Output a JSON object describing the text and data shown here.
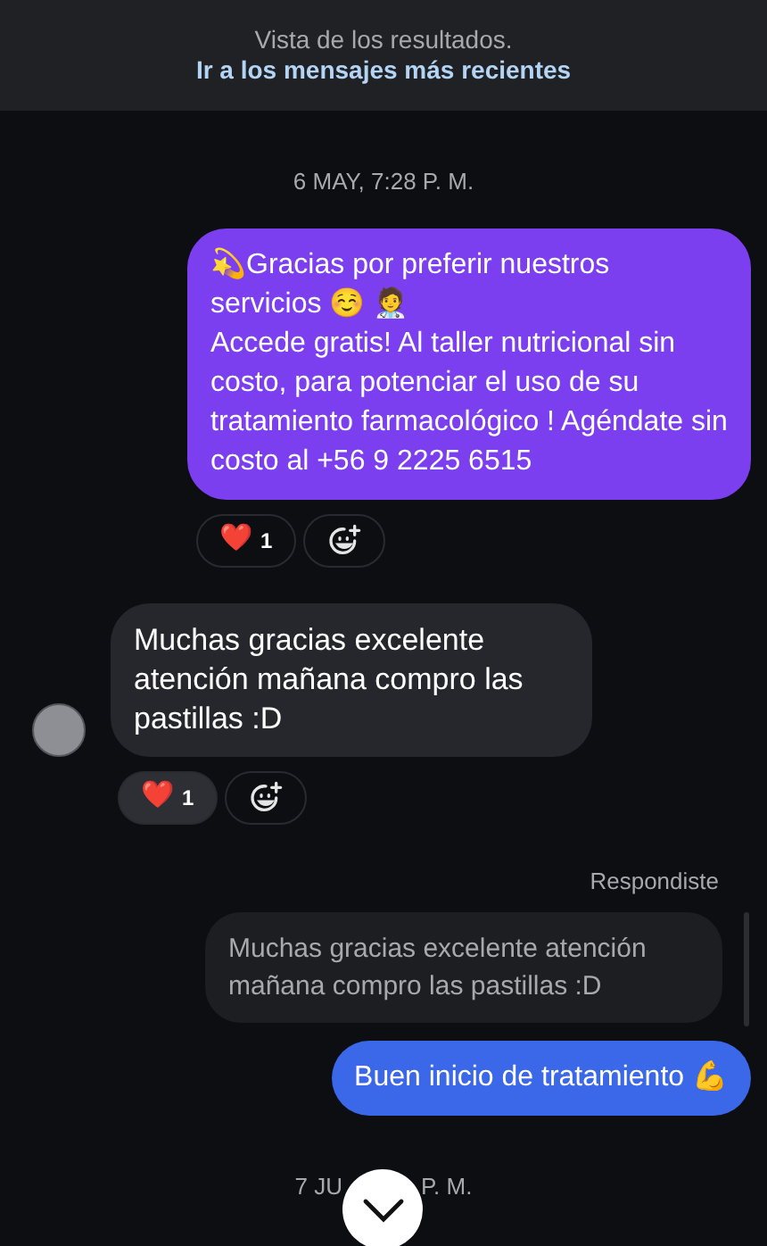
{
  "banner": {
    "text": "Vista de los resultados.",
    "link": "Ir a los mensajes más recientes"
  },
  "messages": [
    {
      "kind": "timestamp",
      "text": "6 MAY, 7:28 P. M."
    },
    {
      "kind": "outgoing",
      "color": "#7b3ff0",
      "lines": [
        "💫Gracias por preferir nuestros servicios ☺️ 🧑‍⚕️",
        "Accede gratis! Al taller nutricional sin costo, para potenciar el uso de su tratamiento farmacológico ! Agéndate sin costo al +56 9 2225 6515"
      ],
      "reactions": [
        {
          "emoji": "❤️",
          "count": "1",
          "mine": false
        }
      ]
    },
    {
      "kind": "incoming",
      "lines": [
        "Muchas gracias excelente atención mañana compro las pastillas :D"
      ],
      "reactions": [
        {
          "emoji": "❤️",
          "count": "1",
          "mine": true
        }
      ]
    },
    {
      "kind": "reply_label",
      "text": "Respondiste"
    },
    {
      "kind": "quote",
      "text": "Muchas gracias excelente atención mañana compro las pastillas :D"
    },
    {
      "kind": "outgoing",
      "color": "#3b67e9",
      "lines": [
        "Buen inicio de tratamiento 💪"
      ]
    },
    {
      "kind": "split_timestamp",
      "parts": [
        "7 JU",
        "P. M."
      ]
    }
  ]
}
